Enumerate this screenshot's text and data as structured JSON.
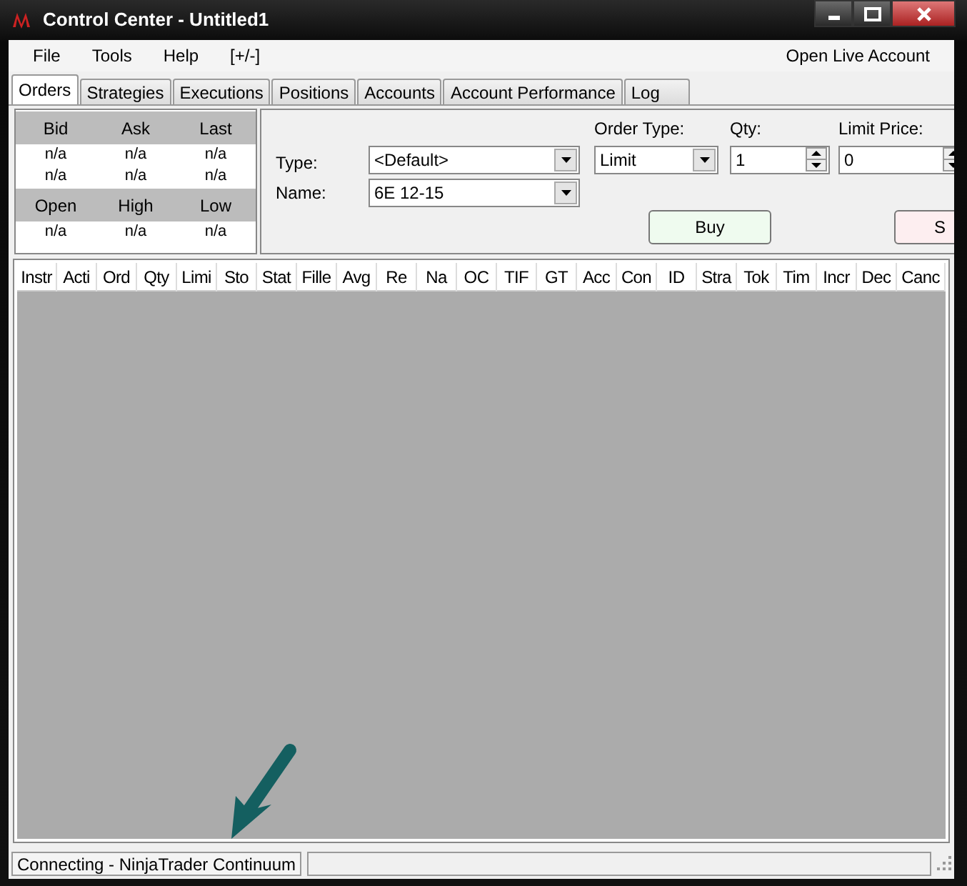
{
  "window": {
    "title": "Control Center - Untitled1"
  },
  "menu": [
    {
      "label": "File"
    },
    {
      "label": "Tools"
    },
    {
      "label": "Help"
    },
    {
      "label": "[+/-]"
    }
  ],
  "menu_right": {
    "label": "Open Live Account"
  },
  "tabs": [
    {
      "label": "Orders",
      "selected": true
    },
    {
      "label": "Strategies",
      "selected": false
    },
    {
      "label": "Executions",
      "selected": false
    },
    {
      "label": "Positions",
      "selected": false
    },
    {
      "label": "Accounts",
      "selected": false
    },
    {
      "label": "Account Performance",
      "selected": false
    },
    {
      "label": "Log",
      "selected": false
    }
  ],
  "quote": {
    "rows": [
      {
        "kind": "header",
        "cells": [
          "Bid",
          "Ask",
          "Last"
        ]
      },
      {
        "kind": "value",
        "cells": [
          "n/a",
          "n/a",
          "n/a"
        ]
      },
      {
        "kind": "value",
        "cells": [
          "n/a",
          "n/a",
          "n/a"
        ]
      },
      {
        "kind": "header",
        "cells": [
          "Open",
          "High",
          "Low"
        ]
      },
      {
        "kind": "value",
        "cells": [
          "n/a",
          "n/a",
          "n/a"
        ]
      }
    ]
  },
  "order": {
    "type_label": "Type:",
    "type_value": "<Default>",
    "name_label": "Name:",
    "name_value": "6E 12-15",
    "order_type_label": "Order Type:",
    "order_type_value": "Limit",
    "qty_label": "Qty:",
    "qty_value": "1",
    "limit_label": "Limit Price:",
    "limit_value": "0",
    "buttons": [
      {
        "label": "Buy",
        "kind": "buy"
      },
      {
        "label": "S",
        "kind": "sell"
      }
    ]
  },
  "table": {
    "columns": [
      "Instr",
      "Acti",
      "Ord",
      "Qty",
      "Limi",
      "Sto",
      "Stat",
      "Fille",
      "Avg",
      "Re",
      "Na",
      "OC",
      "TIF",
      "GT",
      "Acc",
      "Con",
      "ID",
      "Stra",
      "Tok",
      "Tim",
      "Incr",
      "Dec",
      "Canc"
    ]
  },
  "status_bar": {
    "text": "Connecting - NinjaTrader Continuum"
  }
}
